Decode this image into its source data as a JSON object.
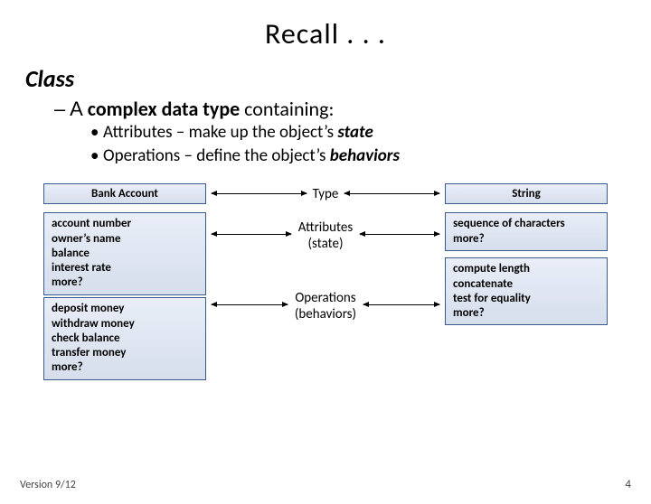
{
  "title": "Recall . . .",
  "heading": "Class",
  "sub_prefix": "– A ",
  "sub_bold": "complex data type",
  "sub_suffix": " containing:",
  "bullets": [
    {
      "pre": "Attributes – make up the object’s ",
      "b": "state"
    },
    {
      "pre": "Operations – define the object’s ",
      "b": "behaviors"
    }
  ],
  "left": {
    "header": "Bank Account",
    "attrs": "account number\nowner’s name\nbalance\ninterest rate\nmore?",
    "ops": "deposit money\nwithdraw money\ncheck balance\ntransfer money\nmore?"
  },
  "center": {
    "type": "Type",
    "attrs_l1": "Attributes",
    "attrs_l2": "(state)",
    "ops_l1": "Operations",
    "ops_l2": "(behaviors)"
  },
  "right": {
    "header": "String",
    "attrs": "sequence of characters\nmore?",
    "ops": "compute length\nconcatenate\ntest for equality\nmore?"
  },
  "footer": {
    "version": "Version 9/12",
    "page": "4"
  }
}
